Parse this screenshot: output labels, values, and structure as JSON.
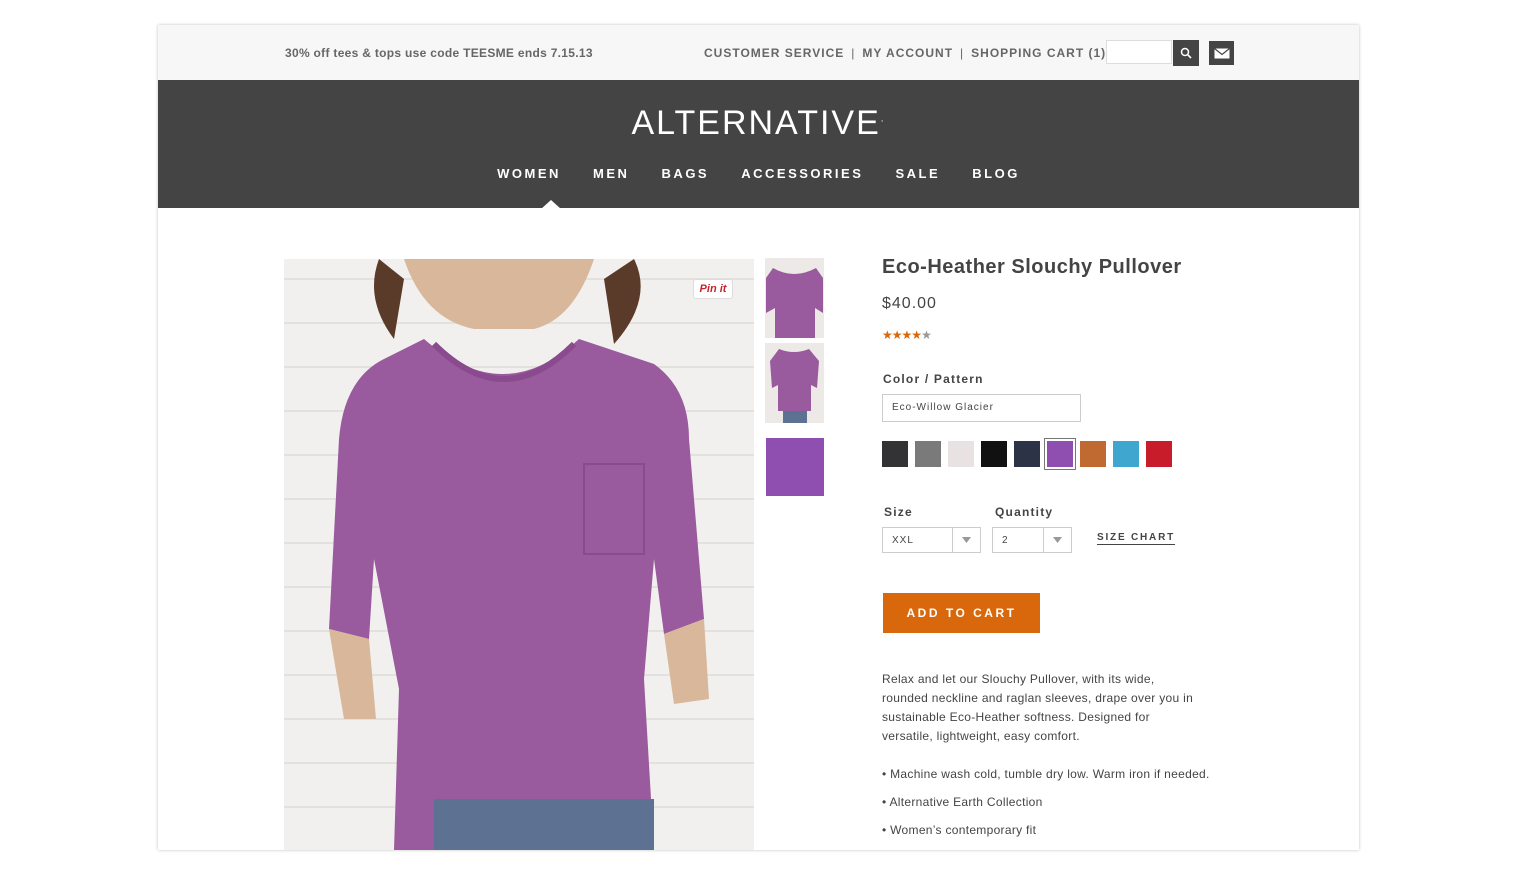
{
  "topbar": {
    "promo": "30% off tees & tops use code TEESME ends 7.15.13",
    "customer_service": "CUSTOMER SERVICE",
    "my_account": "MY ACCOUNT",
    "shopping_cart": "SHOPPING CART (1)",
    "separator": "|",
    "search_value": "",
    "search_icon": "search-icon",
    "mail_icon": "mail-icon"
  },
  "header": {
    "logo": "ALTERNATIVE",
    "logo_mark": ".",
    "nav": [
      "WOMEN",
      "MEN",
      "BAGS",
      "ACCESSORIES",
      "SALE",
      "BLOG"
    ],
    "active_nav": "WOMEN"
  },
  "product": {
    "pin_label": "Pin it",
    "title": "Eco-Heather Slouchy Pullover",
    "price": "$40.00",
    "rating": 4,
    "rating_max": 5,
    "color_label": "Color / Pattern",
    "color_value": "Eco-Willow Glacier",
    "swatches": [
      "#333335",
      "#7a7a7a",
      "#e8e2e2",
      "#111111",
      "#2d3347",
      "#8e4fb0",
      "#c06930",
      "#3fa6cf",
      "#c81c2a"
    ],
    "selected_swatch_index": 5,
    "size_label": "Size",
    "size_value": "XXL",
    "quantity_label": "Quantity",
    "quantity_value": "2",
    "size_chart": "SIZE CHART",
    "add_to_cart": "ADD TO CART",
    "description": "Relax and let our Slouchy Pullover, with its wide, rounded neckline and raglan sleeves, drape over you in sustainable Eco-Heather softness. Designed for versatile, lightweight, easy comfort.",
    "bullets": [
      "• Machine wash cold, tumble dry low. Warm iron if needed.",
      "• Alternative Earth Collection",
      "• Women’s contemporary fit"
    ]
  },
  "colors": {
    "header_bg": "#444444",
    "accent": "#d9670b",
    "product_purple": "#9a5a9e"
  }
}
